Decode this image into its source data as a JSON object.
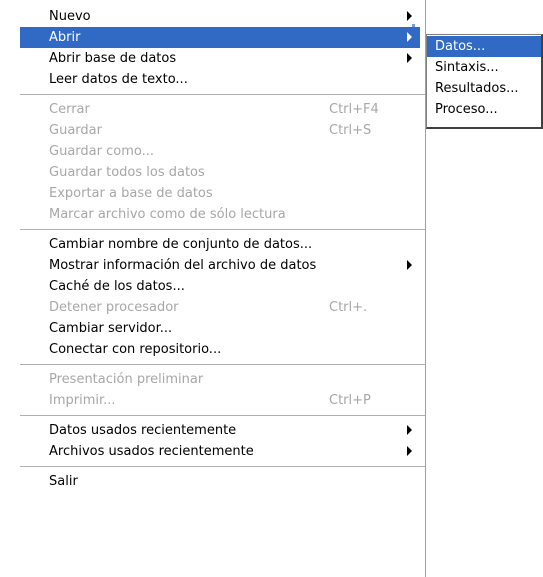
{
  "menu": {
    "groups": [
      [
        {
          "label": "Nuevo",
          "shortcut": "",
          "submenu": true,
          "disabled": false,
          "selected": false
        },
        {
          "label": "Abrir",
          "shortcut": "",
          "submenu": true,
          "disabled": false,
          "selected": true
        },
        {
          "label": "Abrir base de datos",
          "shortcut": "",
          "submenu": true,
          "disabled": false,
          "selected": false
        },
        {
          "label": "Leer datos de texto...",
          "shortcut": "",
          "submenu": false,
          "disabled": false,
          "selected": false
        }
      ],
      [
        {
          "label": "Cerrar",
          "shortcut": "Ctrl+F4",
          "submenu": false,
          "disabled": true,
          "selected": false
        },
        {
          "label": "Guardar",
          "shortcut": "Ctrl+S",
          "submenu": false,
          "disabled": true,
          "selected": false
        },
        {
          "label": "Guardar como...",
          "shortcut": "",
          "submenu": false,
          "disabled": true,
          "selected": false
        },
        {
          "label": "Guardar todos los datos",
          "shortcut": "",
          "submenu": false,
          "disabled": true,
          "selected": false
        },
        {
          "label": "Exportar a base de datos",
          "shortcut": "",
          "submenu": false,
          "disabled": true,
          "selected": false
        },
        {
          "label": "Marcar archivo como de sólo lectura",
          "shortcut": "",
          "submenu": false,
          "disabled": true,
          "selected": false
        }
      ],
      [
        {
          "label": "Cambiar nombre de conjunto de datos...",
          "shortcut": "",
          "submenu": false,
          "disabled": false,
          "selected": false
        },
        {
          "label": "Mostrar información del archivo de datos",
          "shortcut": "",
          "submenu": true,
          "disabled": false,
          "selected": false
        },
        {
          "label": "Caché de los datos...",
          "shortcut": "",
          "submenu": false,
          "disabled": false,
          "selected": false
        },
        {
          "label": "Detener procesador",
          "shortcut": "Ctrl+.",
          "submenu": false,
          "disabled": true,
          "selected": false
        },
        {
          "label": "Cambiar servidor...",
          "shortcut": "",
          "submenu": false,
          "disabled": false,
          "selected": false
        },
        {
          "label": "Conectar con repositorio...",
          "shortcut": "",
          "submenu": false,
          "disabled": false,
          "selected": false
        }
      ],
      [
        {
          "label": "Presentación preliminar",
          "shortcut": "",
          "submenu": false,
          "disabled": true,
          "selected": false
        },
        {
          "label": "Imprimir...",
          "shortcut": "Ctrl+P",
          "submenu": false,
          "disabled": true,
          "selected": false
        }
      ],
      [
        {
          "label": "Datos usados recientemente",
          "shortcut": "",
          "submenu": true,
          "disabled": false,
          "selected": false
        },
        {
          "label": "Archivos usados recientemente",
          "shortcut": "",
          "submenu": true,
          "disabled": false,
          "selected": false
        }
      ],
      [
        {
          "label": "Salir",
          "shortcut": "",
          "submenu": false,
          "disabled": false,
          "selected": false
        }
      ]
    ]
  },
  "submenu": {
    "items": [
      {
        "label": "Datos...",
        "selected": true
      },
      {
        "label": "Sintaxis...",
        "selected": false
      },
      {
        "label": "Resultados...",
        "selected": false
      },
      {
        "label": "Proceso...",
        "selected": false
      }
    ]
  },
  "colors": {
    "highlight": "#316ac5",
    "disabled_text": "#a7a7a7",
    "menu_background": "#ffffff"
  }
}
